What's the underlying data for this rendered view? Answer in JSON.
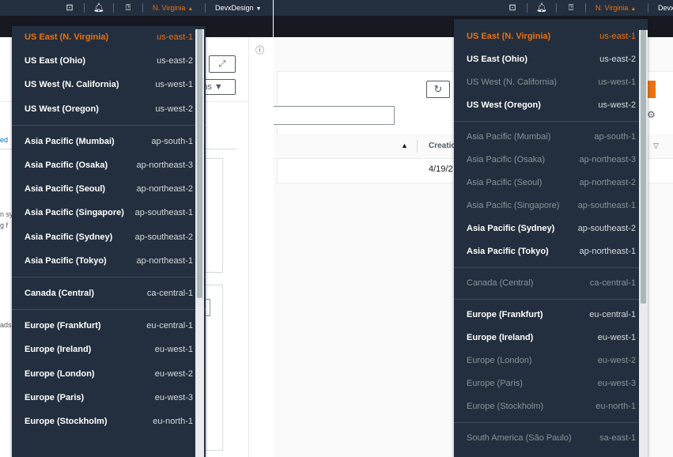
{
  "nav": {
    "region_label": "N. Virginia",
    "account_label": "DevxDesign",
    "account_label_cut": "Devx"
  },
  "left_page": {
    "actions_fragment": "ns",
    "link_fragment": "ed",
    "text_fragment_1": "n sy",
    "text_fragment_2": "g f",
    "text_fragment_3": "ads"
  },
  "right_page": {
    "column_header_fragment": "Creatio",
    "date_fragment": "4/19/2"
  },
  "left_dropdown": {
    "groups": [
      [
        {
          "name": "US East (N. Virginia)",
          "code": "us-east-1",
          "state": "selected"
        },
        {
          "name": "US East (Ohio)",
          "code": "us-east-2",
          "state": "enabled"
        },
        {
          "name": "US West (N. California)",
          "code": "us-west-1",
          "state": "enabled"
        },
        {
          "name": "US West (Oregon)",
          "code": "us-west-2",
          "state": "enabled"
        }
      ],
      [
        {
          "name": "Asia Pacific (Mumbai)",
          "code": "ap-south-1",
          "state": "enabled"
        },
        {
          "name": "Asia Pacific (Osaka)",
          "code": "ap-northeast-3",
          "state": "enabled"
        },
        {
          "name": "Asia Pacific (Seoul)",
          "code": "ap-northeast-2",
          "state": "enabled"
        },
        {
          "name": "Asia Pacific (Singapore)",
          "code": "ap-southeast-1",
          "state": "enabled"
        },
        {
          "name": "Asia Pacific (Sydney)",
          "code": "ap-southeast-2",
          "state": "enabled"
        },
        {
          "name": "Asia Pacific (Tokyo)",
          "code": "ap-northeast-1",
          "state": "enabled"
        }
      ],
      [
        {
          "name": "Canada (Central)",
          "code": "ca-central-1",
          "state": "enabled"
        }
      ],
      [
        {
          "name": "Europe (Frankfurt)",
          "code": "eu-central-1",
          "state": "enabled"
        },
        {
          "name": "Europe (Ireland)",
          "code": "eu-west-1",
          "state": "enabled"
        },
        {
          "name": "Europe (London)",
          "code": "eu-west-2",
          "state": "enabled"
        },
        {
          "name": "Europe (Paris)",
          "code": "eu-west-3",
          "state": "enabled"
        },
        {
          "name": "Europe (Stockholm)",
          "code": "eu-north-1",
          "state": "enabled"
        }
      ]
    ]
  },
  "right_dropdown": {
    "groups": [
      [
        {
          "name": "US East (N. Virginia)",
          "code": "us-east-1",
          "state": "selected"
        },
        {
          "name": "US East (Ohio)",
          "code": "us-east-2",
          "state": "enabled"
        },
        {
          "name": "US West (N. California)",
          "code": "us-west-1",
          "state": "disabled"
        },
        {
          "name": "US West (Oregon)",
          "code": "us-west-2",
          "state": "enabled"
        }
      ],
      [
        {
          "name": "Asia Pacific (Mumbai)",
          "code": "ap-south-1",
          "state": "disabled"
        },
        {
          "name": "Asia Pacific (Osaka)",
          "code": "ap-northeast-3",
          "state": "disabled"
        },
        {
          "name": "Asia Pacific (Seoul)",
          "code": "ap-northeast-2",
          "state": "disabled"
        },
        {
          "name": "Asia Pacific (Singapore)",
          "code": "ap-southeast-1",
          "state": "disabled"
        },
        {
          "name": "Asia Pacific (Sydney)",
          "code": "ap-southeast-2",
          "state": "enabled"
        },
        {
          "name": "Asia Pacific (Tokyo)",
          "code": "ap-northeast-1",
          "state": "enabled"
        }
      ],
      [
        {
          "name": "Canada (Central)",
          "code": "ca-central-1",
          "state": "disabled"
        }
      ],
      [
        {
          "name": "Europe (Frankfurt)",
          "code": "eu-central-1",
          "state": "enabled"
        },
        {
          "name": "Europe (Ireland)",
          "code": "eu-west-1",
          "state": "enabled"
        },
        {
          "name": "Europe (London)",
          "code": "eu-west-2",
          "state": "disabled"
        },
        {
          "name": "Europe (Paris)",
          "code": "eu-west-3",
          "state": "disabled"
        },
        {
          "name": "Europe (Stockholm)",
          "code": "eu-north-1",
          "state": "disabled"
        }
      ],
      [
        {
          "name": "South America (São Paulo)",
          "code": "sa-east-1",
          "state": "disabled"
        }
      ]
    ]
  },
  "colors": {
    "nav_bg": "#232f3e",
    "accent": "#ec7211",
    "disabled_text": "#879596"
  },
  "icons": [
    "cloudshell-icon",
    "bell-icon",
    "help-icon",
    "expand-icon",
    "info-icon",
    "refresh-icon",
    "settings-icon",
    "sort-up-icon",
    "sort-down-icon"
  ]
}
